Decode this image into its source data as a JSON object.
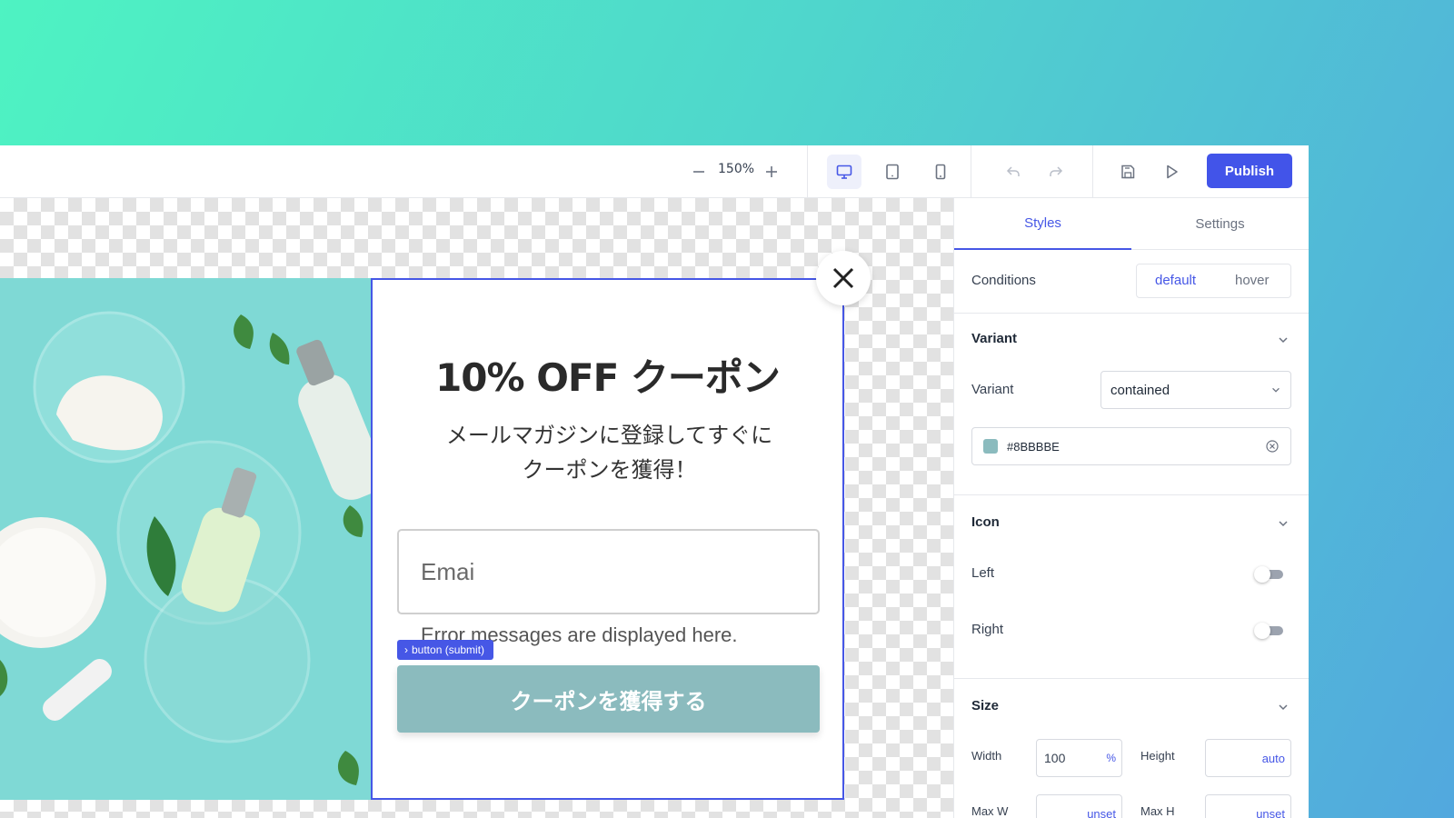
{
  "toolbar": {
    "zoom_out_icon": "minus-icon",
    "zoom_level": "150%",
    "zoom_in_icon": "plus-icon",
    "devices": [
      "desktop-icon",
      "tablet-icon",
      "mobile-icon"
    ],
    "publish_label": "Publish"
  },
  "popup": {
    "title": "10% OFF クーポン",
    "subtitle_line1": "メールマガジンに登録してすぐに",
    "subtitle_line2": "クーポンを獲得！",
    "email_placeholder": "Emai",
    "error_message": "Error messages are displayed here.",
    "selection_tag": "button (submit)",
    "submit_label": "クーポンを獲得する",
    "button_color": "#8BBBBE"
  },
  "panel": {
    "tabs": [
      "Styles",
      "Settings"
    ],
    "conditions_label": "Conditions",
    "conditions_options": [
      "default",
      "hover"
    ],
    "variant_section": "Variant",
    "variant_label": "Variant",
    "variant_value": "contained",
    "color_value": "#8BBBBE",
    "icon_section": "Icon",
    "icon_left_label": "Left",
    "icon_right_label": "Right",
    "size_section": "Size",
    "width_label": "Width",
    "width_value": "100",
    "width_unit": "%",
    "height_label": "Height",
    "height_value": "auto",
    "max_w_label": "Max W",
    "max_w_value": "unset",
    "max_h_label": "Max H",
    "max_h_value": "unset"
  },
  "colors": {
    "accent": "#4254E9",
    "popup_button": "#8BBBBE"
  }
}
